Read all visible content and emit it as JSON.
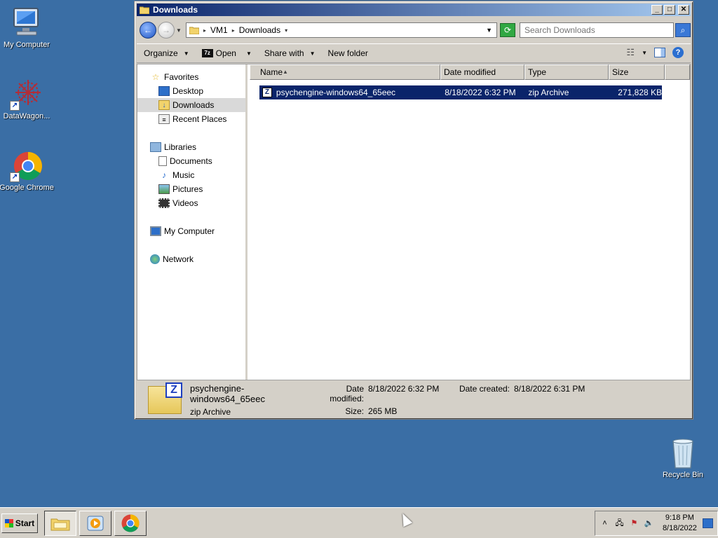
{
  "desktop": {
    "icons": [
      {
        "label": "My Computer"
      },
      {
        "label": "DataWagon..."
      },
      {
        "label": "Google Chrome"
      },
      {
        "label": "Recycle Bin"
      }
    ]
  },
  "window": {
    "title": "Downloads",
    "breadcrumb": [
      "VM1",
      "Downloads"
    ],
    "search_placeholder": "Search Downloads"
  },
  "toolbar": {
    "organize": "Organize",
    "open": "Open",
    "open_badge": "7z",
    "share_with": "Share with",
    "new_folder": "New folder"
  },
  "navpane": {
    "favorites": "Favorites",
    "desktop": "Desktop",
    "downloads": "Downloads",
    "recent_places": "Recent Places",
    "libraries": "Libraries",
    "documents": "Documents",
    "music": "Music",
    "pictures": "Pictures",
    "videos": "Videos",
    "my_computer": "My Computer",
    "network": "Network"
  },
  "columns": {
    "name": "Name",
    "date_modified": "Date modified",
    "type": "Type",
    "size": "Size"
  },
  "files": [
    {
      "name": "psychengine-windows64_65eec",
      "date_modified": "8/18/2022 6:32 PM",
      "type": "zip Archive",
      "size": "271,828 KB"
    }
  ],
  "details": {
    "name": "psychengine-windows64_65eec",
    "type": "zip Archive",
    "date_modified_label": "Date modified:",
    "date_modified": "8/18/2022 6:32 PM",
    "date_created_label": "Date created:",
    "date_created": "8/18/2022 6:31 PM",
    "size_label": "Size:",
    "size": "265 MB"
  },
  "taskbar": {
    "start": "Start",
    "time": "9:18 PM",
    "date": "8/18/2022"
  },
  "colors": {
    "desktop_bg": "#3a6ea5",
    "selection": "#0a246a",
    "chrome": "#d4d0c8"
  }
}
